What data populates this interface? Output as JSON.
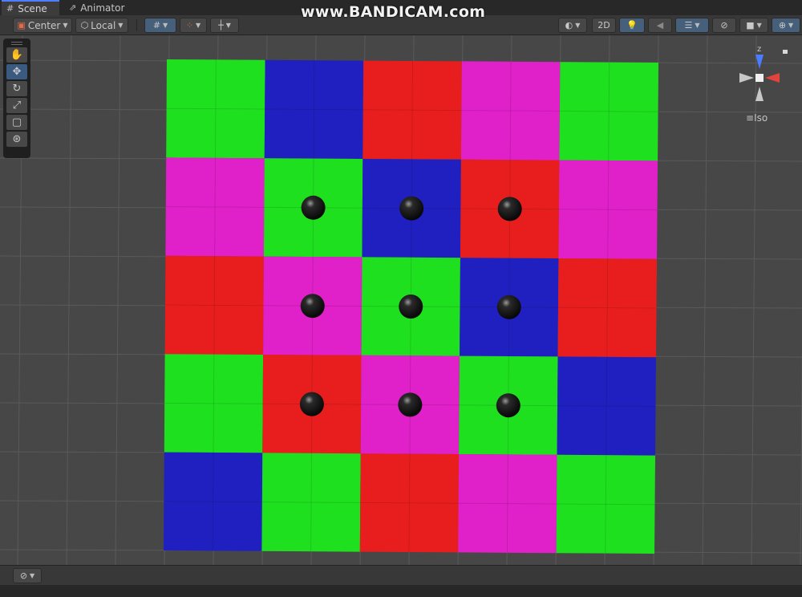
{
  "tabs": [
    {
      "label": "Scene",
      "icon": "grid-icon",
      "active": true
    },
    {
      "label": "Animator",
      "icon": "animator-icon",
      "active": false
    }
  ],
  "watermark": "www.BANDICAM.com",
  "toolbar": {
    "pivot_mode": "Center",
    "pivot_rotation": "Local",
    "mode_2d": "2D",
    "colors": {
      "active_button": "#46607c",
      "button": "#474747"
    }
  },
  "palette": {
    "tools": [
      "hand-tool-icon",
      "move-tool-icon",
      "rotate-tool-icon",
      "scale-tool-icon",
      "rect-tool-icon",
      "transform-tool-icon"
    ],
    "active_tool": "move-tool-icon"
  },
  "gizmo": {
    "axis_z": "z",
    "projection": "Iso"
  },
  "board": {
    "colors": {
      "green": "#1fe01f",
      "blue": "#2020c0",
      "red": "#e81e1e",
      "magenta": "#e020c8"
    },
    "rows": [
      [
        "green",
        "blue",
        "red",
        "magenta",
        "green"
      ],
      [
        "magenta",
        "green",
        "blue",
        "red",
        "magenta"
      ],
      [
        "red",
        "magenta",
        "green",
        "blue",
        "red"
      ],
      [
        "green",
        "red",
        "magenta",
        "green",
        "blue"
      ],
      [
        "blue",
        "green",
        "red",
        "magenta",
        "green"
      ]
    ],
    "balls": [
      [
        1,
        1
      ],
      [
        1,
        2
      ],
      [
        1,
        3
      ],
      [
        2,
        1
      ],
      [
        2,
        2
      ],
      [
        2,
        3
      ],
      [
        3,
        1
      ],
      [
        3,
        2
      ],
      [
        3,
        3
      ]
    ]
  },
  "statusbar": {
    "icon": "gizmos-icon"
  }
}
